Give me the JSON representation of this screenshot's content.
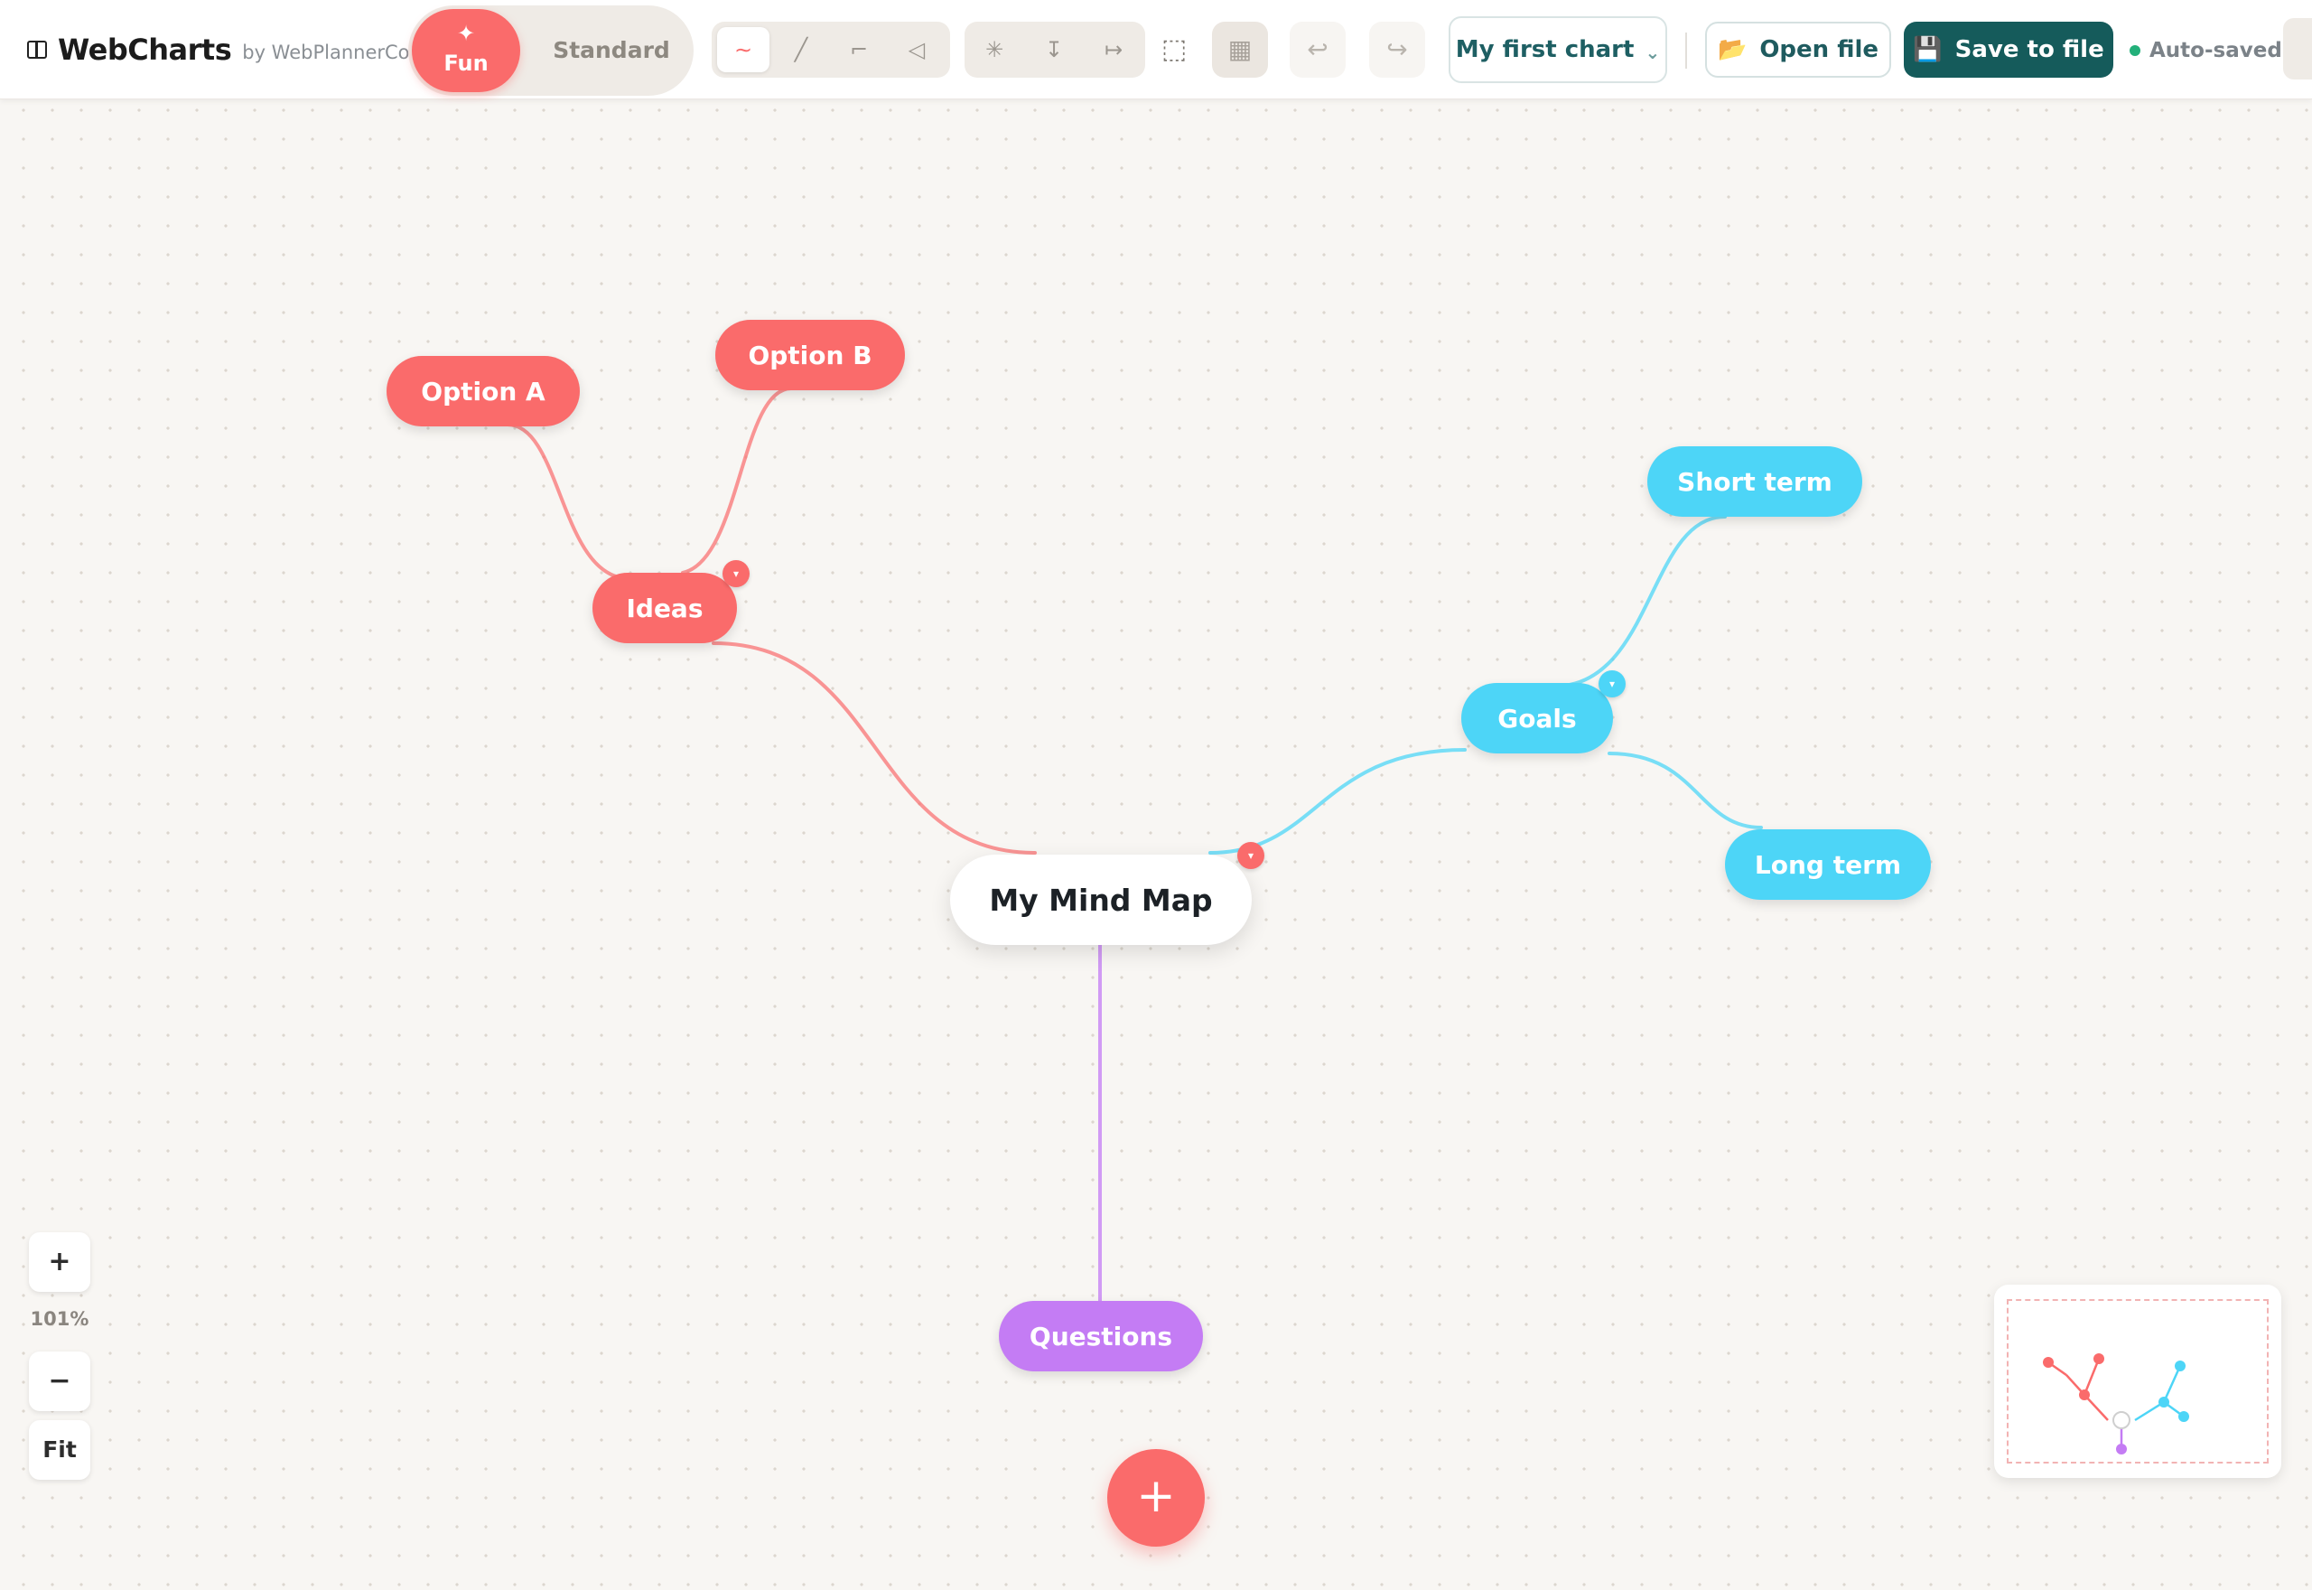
{
  "app": {
    "name": "WebCharts",
    "by": "by WebPlannerCo"
  },
  "modes": {
    "fun_label": "Fun",
    "fun_icon": "✦",
    "standard_label": "Standard"
  },
  "tools": {
    "curve": "∼",
    "straight": "╱",
    "elbow": "⌐",
    "arrow": "◁",
    "radial": "✳",
    "vertical": "↧",
    "horizontal": "↦",
    "select": "⬚",
    "grid": "▦",
    "undo": "↩",
    "redo": "↪"
  },
  "chart_select": {
    "value": "My first chart",
    "chevron": "⌄"
  },
  "buttons": {
    "open_label": "Open file",
    "open_icon": "📂",
    "save_label": "Save to file",
    "save_icon": "💾"
  },
  "status": {
    "autosave": "Auto-saved"
  },
  "mindmap": {
    "root": "My Mind Map",
    "nodes": {
      "ideas": "Ideas",
      "option_a": "Option A",
      "option_b": "Option B",
      "goals": "Goals",
      "short_term": "Short term",
      "long_term": "Long term",
      "questions": "Questions"
    },
    "collapse_icon": "▾"
  },
  "branch_colors": {
    "ideas": "#fa6b6b",
    "goals": "#4dd5f7",
    "questions": "#c47cf4"
  },
  "zoom": {
    "in": "+",
    "level": "101%",
    "out": "−",
    "fit": "Fit"
  },
  "fab": {
    "icon": "+"
  }
}
